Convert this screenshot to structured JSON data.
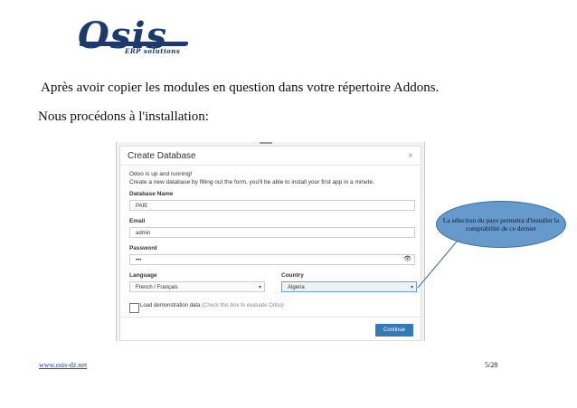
{
  "logo": {
    "text": "Osis",
    "subtitle": "ERP solutions",
    "color": "#1c3a6e"
  },
  "paragraphs": {
    "intro": "Après avoir copier les modules en question dans votre répertoire Addons.",
    "install": "Nous procédons à l'installation:"
  },
  "dialog": {
    "title": "Create Database",
    "close": "×",
    "line1": "Odoo is up and running!",
    "line2": "Create a new database by filling out the form, you'll be able to install your first app in a minute.",
    "fields": {
      "database_name": {
        "label": "Database Name",
        "value": "PAIE"
      },
      "email": {
        "label": "Email",
        "value": "admin"
      },
      "password": {
        "label": "Password",
        "value": "•••"
      },
      "language": {
        "label": "Language",
        "value": "French / Français"
      },
      "country": {
        "label": "Country",
        "value": "Algeria"
      }
    },
    "demo": {
      "label": "Load demonstration data",
      "hint": "(Check this box to evaluate Odoo)"
    },
    "continue_button": "Continue",
    "accent_color": "#337ab7"
  },
  "callout": {
    "text": "La sélection du pays permetra d'installer la comptabilité de ce dernier",
    "color": "#6699cc"
  },
  "footer": {
    "link": "www.osis-dz.net",
    "page": "5/28"
  }
}
